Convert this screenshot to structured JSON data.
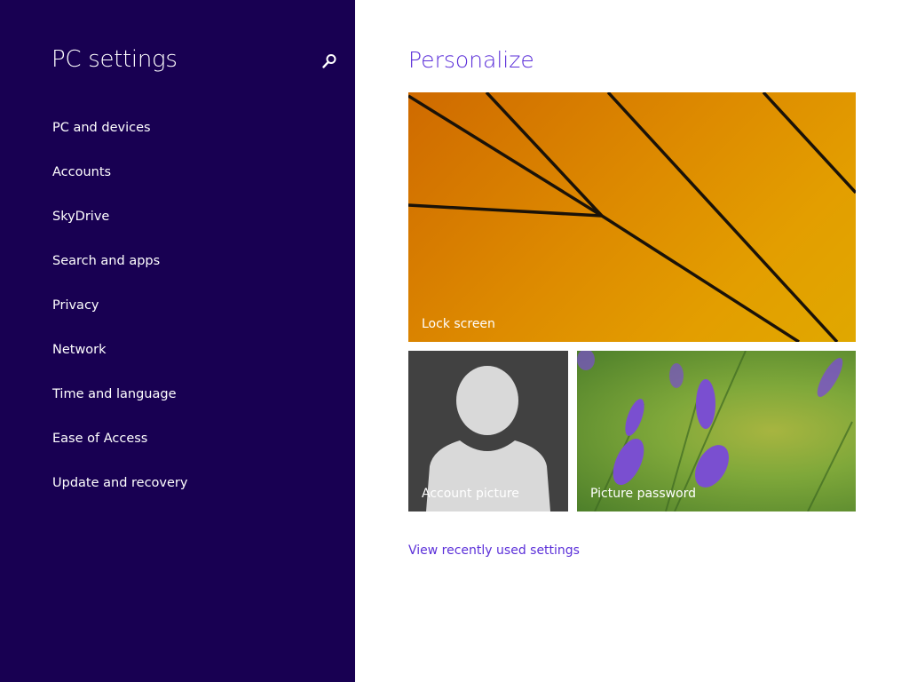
{
  "sidebar": {
    "title": "PC settings",
    "search_icon": "search-icon",
    "items": [
      {
        "label": "PC and devices"
      },
      {
        "label": "Accounts"
      },
      {
        "label": "SkyDrive"
      },
      {
        "label": "Search and apps"
      },
      {
        "label": "Privacy"
      },
      {
        "label": "Network"
      },
      {
        "label": "Time and language"
      },
      {
        "label": "Ease of Access"
      },
      {
        "label": "Update and recovery"
      }
    ]
  },
  "main": {
    "title": "Personalize",
    "tiles": {
      "lock_screen": "Lock screen",
      "account_picture": "Account picture",
      "picture_password": "Picture password"
    },
    "recent_link": "View recently used settings"
  },
  "colors": {
    "sidebar": "#180052",
    "accent": "#5b2fd9"
  }
}
